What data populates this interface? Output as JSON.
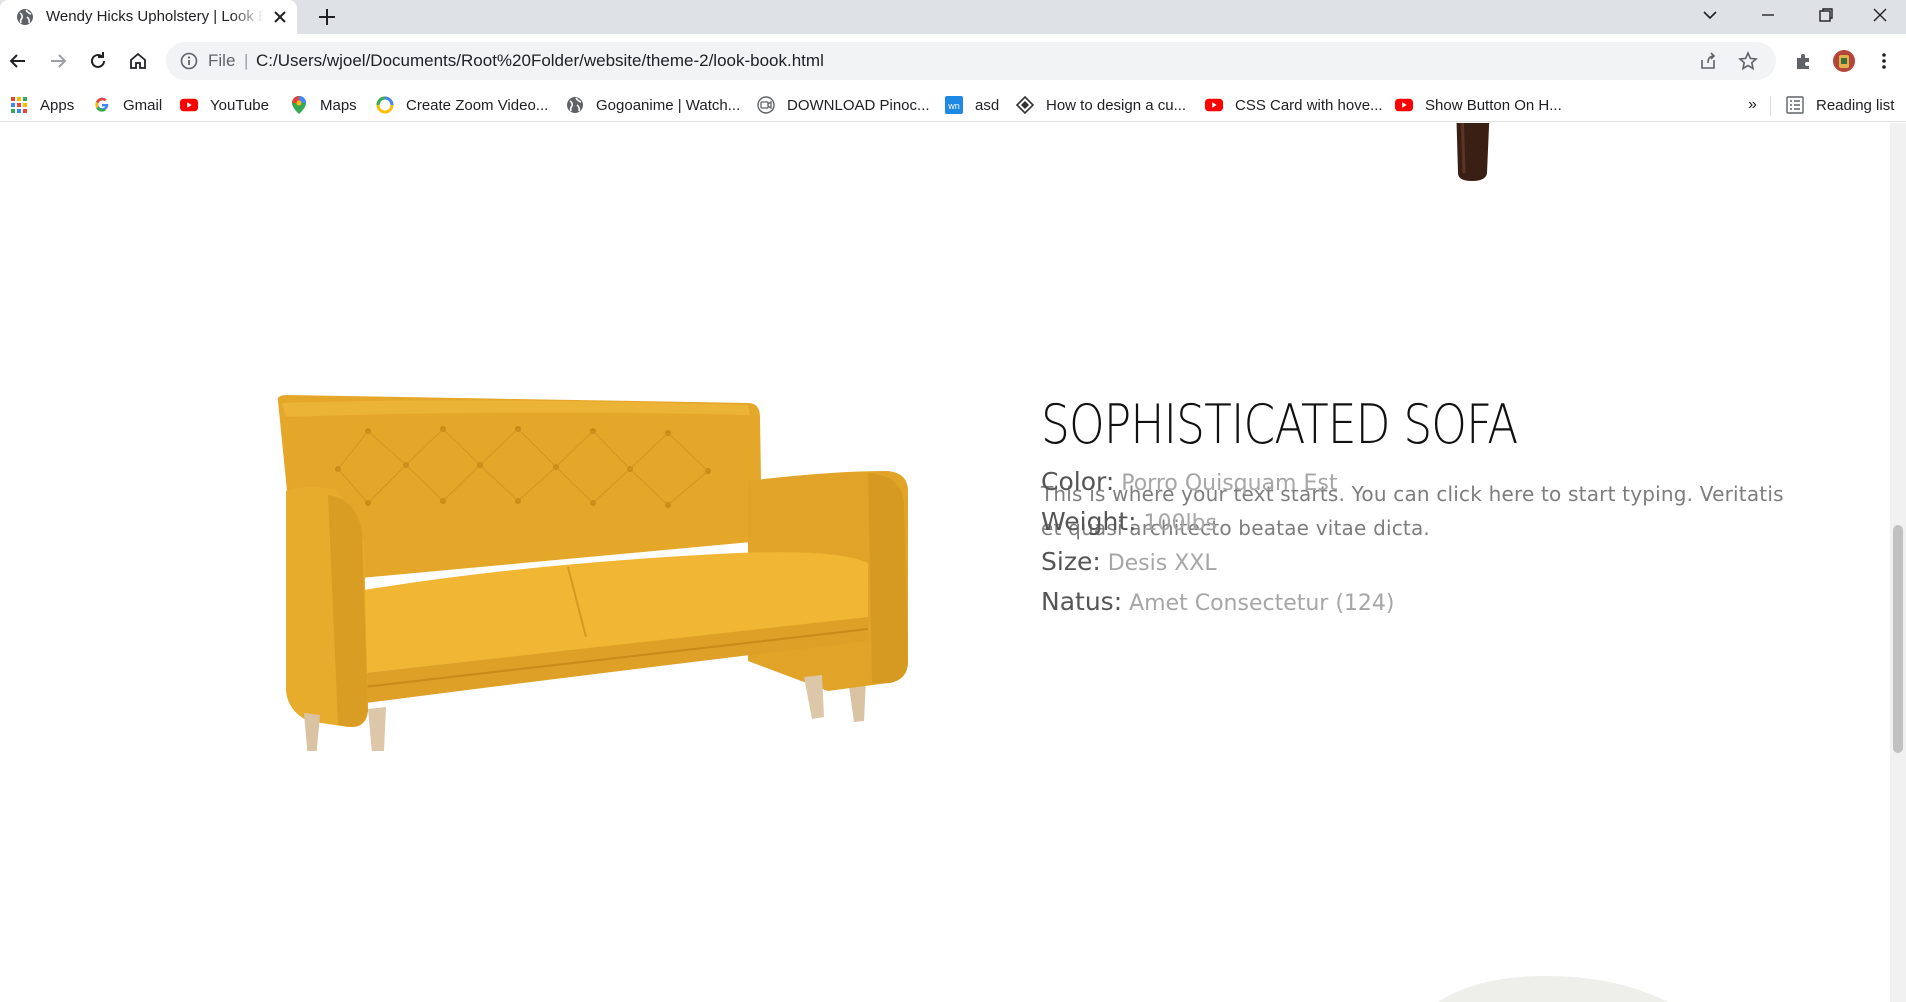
{
  "browser": {
    "tab": {
      "title": "Wendy Hicks Upholstery | Look Book"
    },
    "address_bar": {
      "scheme": "File",
      "separator": "|",
      "url": "C:/Users/wjoel/Documents/Root%20Folder/website/theme-2/look-book.html"
    },
    "bookmarks": [
      {
        "label": "Apps",
        "icon": "apps-grid-icon"
      },
      {
        "label": "Gmail",
        "icon": "google-icon"
      },
      {
        "label": "YouTube",
        "icon": "youtube-icon"
      },
      {
        "label": "Maps",
        "icon": "maps-pin-icon"
      },
      {
        "label": "Create Zoom Video...",
        "icon": "colorful-swirl-icon"
      },
      {
        "label": "Gogoanime | Watch...",
        "icon": "globe-icon"
      },
      {
        "label": "DOWNLOAD Pinoc...",
        "icon": "video-camera-icon"
      },
      {
        "label": "asd",
        "icon": "wn-icon"
      },
      {
        "label": "How to design a cu...",
        "icon": "diamond-icon"
      },
      {
        "label": "CSS Card with hove...",
        "icon": "youtube-icon"
      },
      {
        "label": "Show Button On H...",
        "icon": "youtube-icon"
      }
    ],
    "overflow": "»",
    "reading_list": "Reading list",
    "colors": {
      "tabstrip": "#dee1e6",
      "omnibox": "#f1f3f4",
      "youtube_red": "#ff0000"
    }
  },
  "product": {
    "title": "SOPHISTICATED SOFA",
    "description": "This is where your text starts. You can click here to start typing. Veritatis et quasi architecto beatae vitae dicta.",
    "specs": [
      {
        "label": "Color:",
        "value": "Porro Quisquam Est"
      },
      {
        "label": "Weight:",
        "value": "100lbs"
      },
      {
        "label": "Size:",
        "value": "Desis XXL"
      },
      {
        "label": "Natus:",
        "value": "Amet Consectetur (124)"
      }
    ],
    "colors": {
      "sofa": "#e8ac2c",
      "legs": "#d9c3a3"
    }
  }
}
